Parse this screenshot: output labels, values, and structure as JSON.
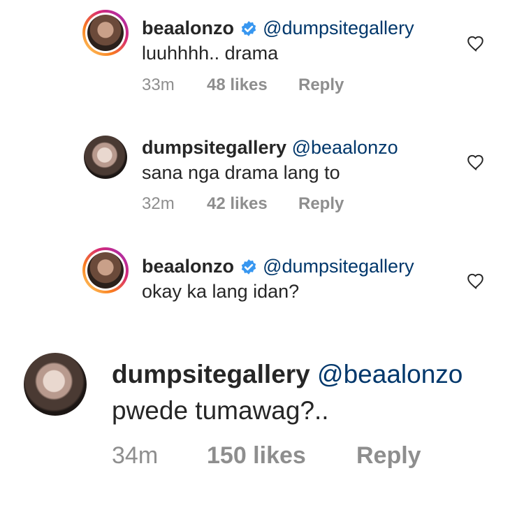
{
  "comments": [
    {
      "username": "beaalonzo",
      "verified": true,
      "mention": "@dumpsitegallery",
      "text": "luuhhhh.. drama",
      "time": "33m",
      "likes": "48 likes",
      "reply": "Reply"
    },
    {
      "username": "dumpsitegallery",
      "verified": false,
      "mention": "@beaalonzo",
      "text": "sana nga drama lang to",
      "time": "32m",
      "likes": "42 likes",
      "reply": "Reply"
    },
    {
      "username": "beaalonzo",
      "verified": true,
      "mention": "@dumpsitegallery",
      "text": "okay ka lang idan?",
      "time": "",
      "likes": "",
      "reply": ""
    },
    {
      "username": "dumpsitegallery",
      "verified": false,
      "mention": "@beaalonzo",
      "text": "pwede tumawag?..",
      "time": "34m",
      "likes": "150 likes",
      "reply": "Reply"
    }
  ],
  "icons": {
    "verified": "verified-badge-icon",
    "like": "heart-outline-icon"
  },
  "colors": {
    "mention": "#00376b",
    "meta": "#8e8e8e",
    "verified": "#3897f0"
  }
}
